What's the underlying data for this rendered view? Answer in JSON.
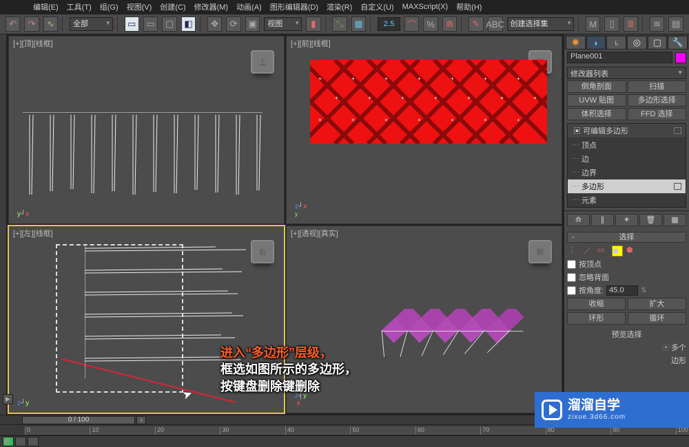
{
  "menu": [
    "编辑(E)",
    "工具(T)",
    "组(G)",
    "视图(V)",
    "创建(C)",
    "修改器(M)",
    "动画(A)",
    "图形编辑器(D)",
    "渲染(R)",
    "自定义(U)",
    "MAXScript(X)",
    "帮助(H)"
  ],
  "toolbar": {
    "sel_filter": "全部",
    "ref_coord": "视图",
    "spinner": "2.5",
    "named_sel": "创建选择集"
  },
  "viewports": {
    "tl": {
      "label": "[+][顶][线框]",
      "cube": "上"
    },
    "tr": {
      "label": "[+][前][线框]",
      "cube": "前"
    },
    "bl": {
      "label": "[+][左][线框]",
      "cube": "右"
    },
    "br": {
      "label": "[+][透视][真实]",
      "cube": "前"
    }
  },
  "cmd": {
    "obj_name": "Plane001",
    "modifier_list": "修改器列表",
    "buttons": [
      "倒角剖面",
      "扫描",
      "UVW 贴图",
      "多边形选择",
      "体积选择",
      "FFD 选择"
    ],
    "stack": {
      "head": "可编辑多边形",
      "items": [
        "顶点",
        "边",
        "边界",
        "多边形",
        "元素"
      ],
      "selected": "多边形"
    },
    "rollout_sel": "选择",
    "chk_vertex": "按顶点",
    "chk_ignore": "忽略背面",
    "chk_angle": "按角度:",
    "angle_val": "45.0",
    "shrink": "收缩",
    "grow": "扩大",
    "ring": "环形",
    "loop": "循环",
    "preview_hdr": "预览选择",
    "preview_multi": "多个",
    "preview_poly": "边形"
  },
  "timeline": {
    "slider": "0 / 100",
    "ticks": [
      "0",
      "10",
      "20",
      "30",
      "40",
      "50",
      "60",
      "70",
      "80",
      "90",
      "100"
    ]
  },
  "overlay": {
    "hl": "进入“多边形”层级，",
    "line2": "框选如图所示的多边形，",
    "line3": "按键盘删除键删除"
  },
  "logo": {
    "name": "溜溜自学",
    "url": "zixue.3d66.com"
  }
}
